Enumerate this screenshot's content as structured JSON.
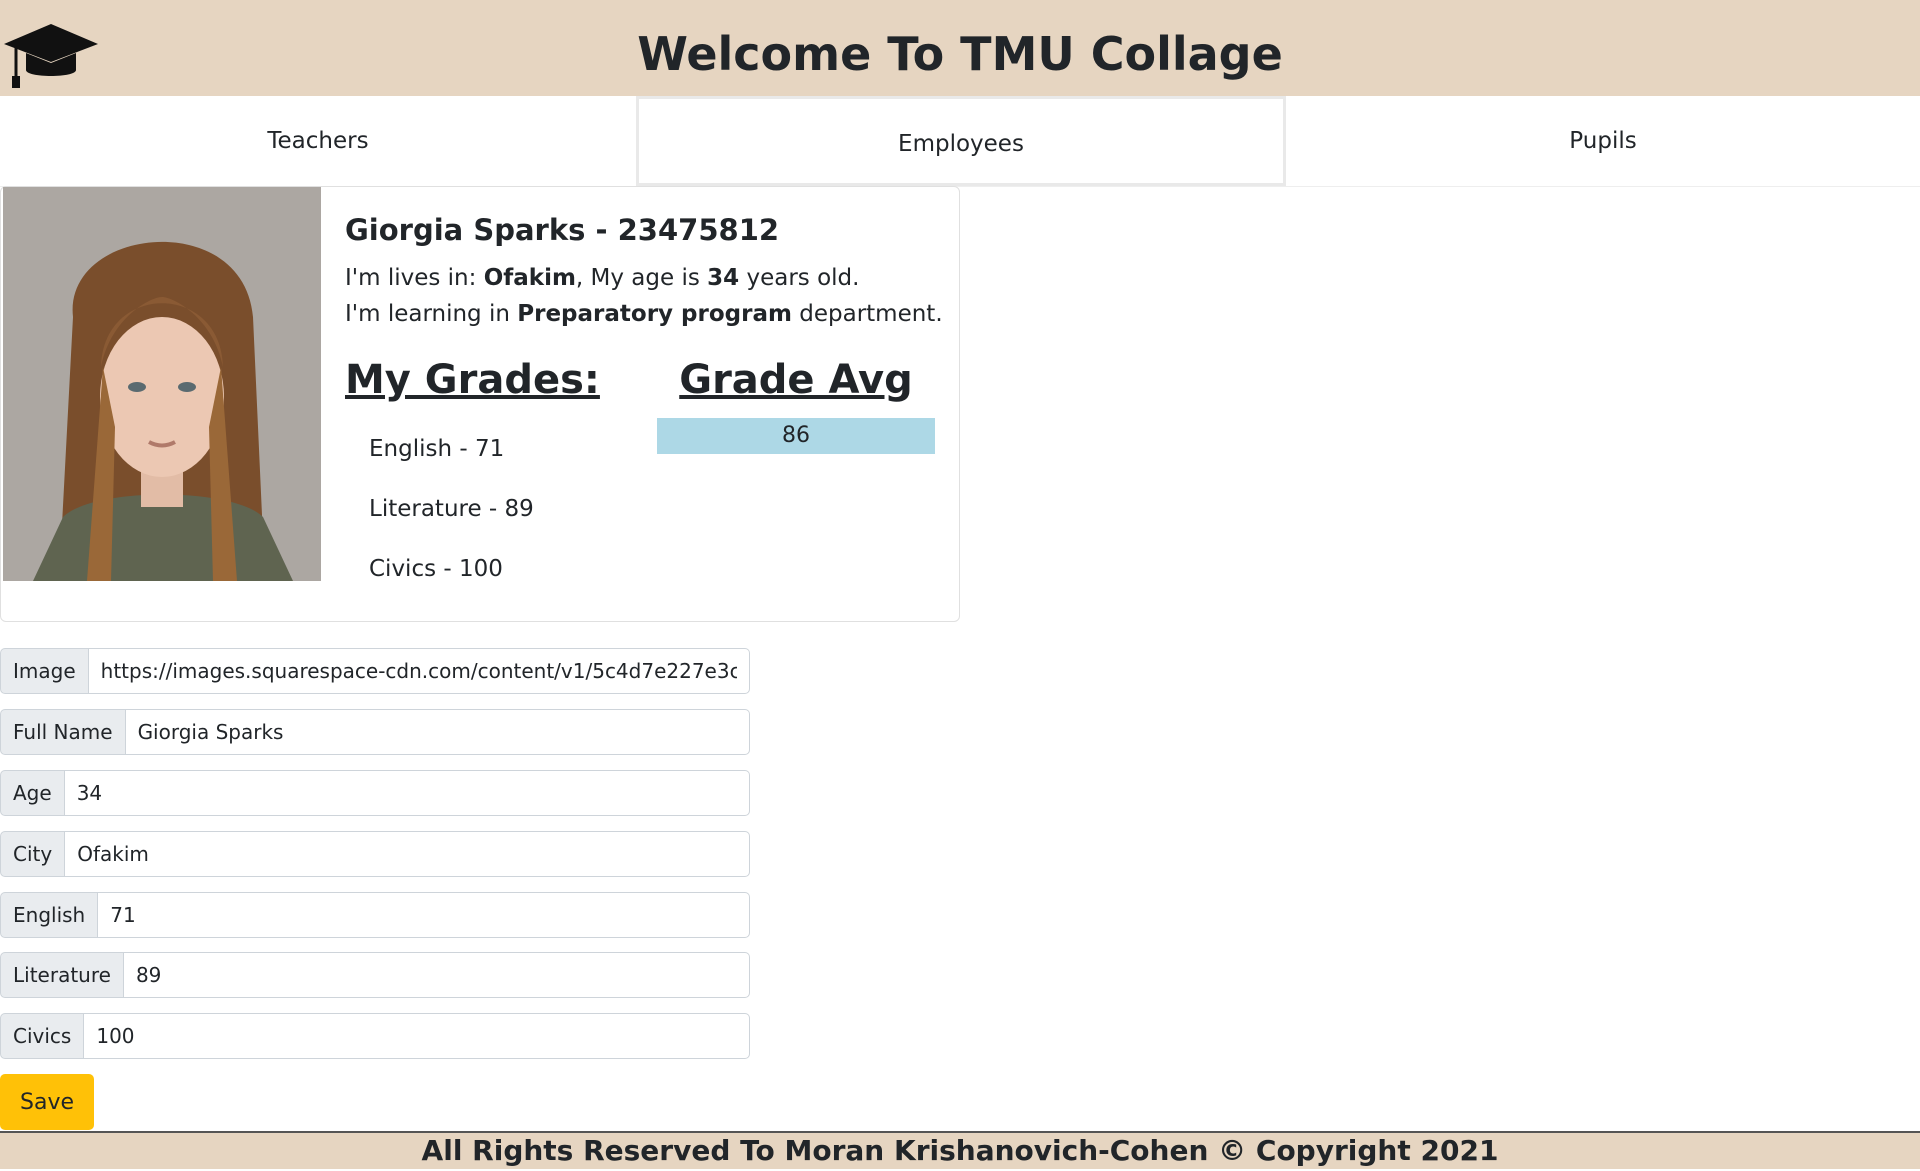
{
  "header": {
    "title": "Welcome To TMU Collage",
    "logo_icon": "graduation-cap-icon"
  },
  "nav": {
    "items": [
      {
        "label": "Teachers",
        "active": false
      },
      {
        "label": "Employees",
        "active": true
      },
      {
        "label": "Pupils",
        "active": false
      }
    ]
  },
  "card": {
    "name_id": "Giorgia Sparks - 23475812",
    "lives_prefix": "I'm lives in: ",
    "city": "Ofakim",
    "age_prefix": ", My age is ",
    "age": "34",
    "age_suffix": " years old.",
    "learning_prefix": "I'm learning in ",
    "department": "Preparatory program",
    "learning_suffix": " department.",
    "grades_title": "My Grades:",
    "grades": [
      "English - 71",
      "Literature - 89",
      "Civics - 100"
    ],
    "avg_title": "Grade Avg",
    "avg_value": "86",
    "avg_fraction": 1.0
  },
  "form": {
    "image_label": "Image",
    "image_value": "https://images.squarespace-cdn.com/content/v1/5c4d7e227e3c3a6ec",
    "fullname_label": "Full Name",
    "fullname_value": "Giorgia Sparks",
    "age_label": "Age",
    "age_value": "34",
    "city_label": "City",
    "city_value": "Ofakim",
    "english_label": "English",
    "english_value": "71",
    "literature_label": "Literature",
    "literature_value": "89",
    "civics_label": "Civics",
    "civics_value": "100",
    "save_label": "Save"
  },
  "footer": {
    "text": "All Rights Reserved To Moran Krishanovich-Cohen © Copyright 2021"
  },
  "colors": {
    "header_bg": "#e6d5c1",
    "avg_bar": "#add8e6",
    "save_button": "#ffc107"
  }
}
